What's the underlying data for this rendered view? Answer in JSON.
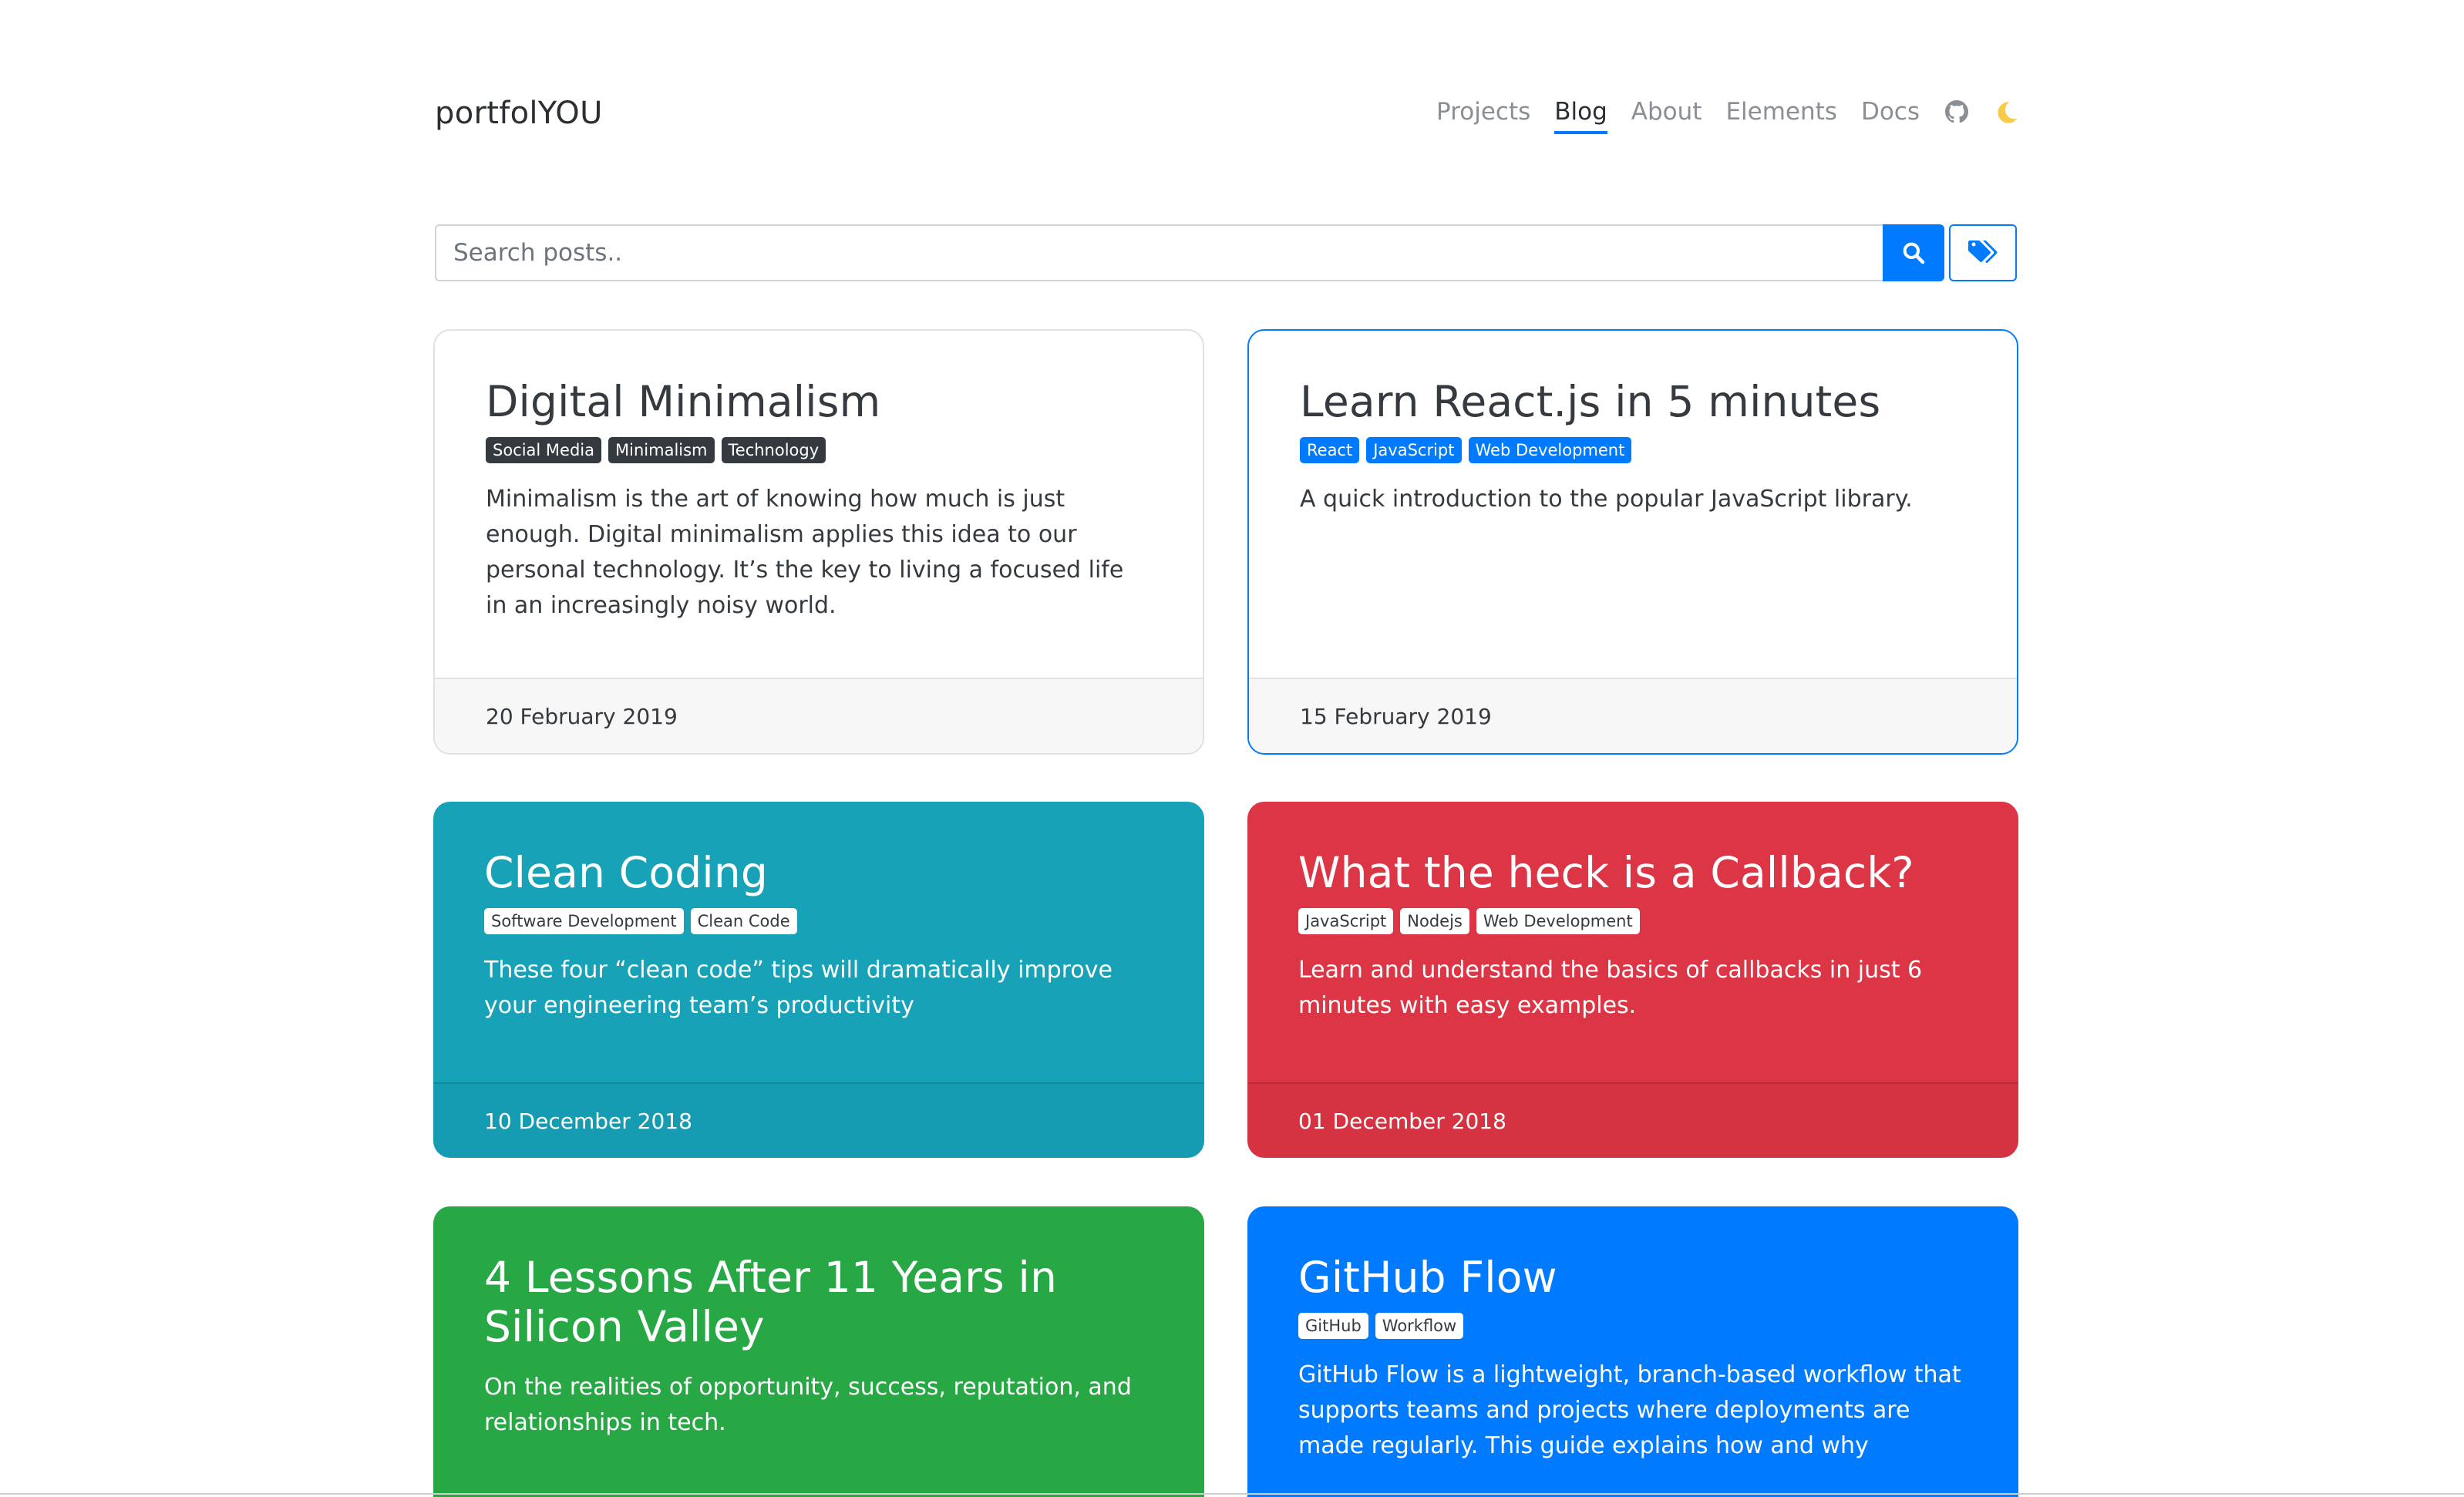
{
  "brand": "portfolYOU",
  "nav": {
    "links": [
      "Projects",
      "Blog",
      "About",
      "Elements",
      "Docs"
    ],
    "active": "Blog",
    "icons": [
      "github-icon",
      "moon-icon"
    ]
  },
  "search": {
    "placeholder": "Search posts..",
    "button_icon": "search-icon",
    "tags_button_icon": "tags-icon"
  },
  "colors": {
    "primary": "#007bff",
    "info": "#17a2b8",
    "danger": "#dc3545",
    "success": "#28a745",
    "dark": "#343a40"
  },
  "posts": [
    {
      "title": "Digital Minimalism",
      "tags": [
        "Social Media",
        "Minimalism",
        "Technology"
      ],
      "excerpt": "Minimalism is the art of knowing how much is just enough. Digital minimalism applies this idea to our personal technology. It’s the key to living a focused life in an increasingly noisy world.",
      "date": "20 February 2019"
    },
    {
      "title": "Learn React.js in 5 minutes",
      "tags": [
        "React",
        "JavaScript",
        "Web Development"
      ],
      "excerpt": "A quick introduction to the popular JavaScript library.",
      "date": "15 February 2019"
    },
    {
      "title": "Clean Coding",
      "tags": [
        "Software Development",
        "Clean Code"
      ],
      "excerpt": "These four “clean code” tips will dramatically improve your engineering team’s productivity",
      "date": "10 December 2018"
    },
    {
      "title": "What the heck is a Callback?",
      "tags": [
        "JavaScript",
        "Nodejs",
        "Web Development"
      ],
      "excerpt": "Learn and understand the basics of callbacks in just 6 minutes with easy examples.",
      "date": "01 December 2018"
    },
    {
      "title": "4 Lessons After 11 Years in Silicon Valley",
      "tags": [],
      "excerpt": "On the realities of opportunity, success, reputation, and relationships in tech.",
      "date": ""
    },
    {
      "title": "GitHub Flow",
      "tags": [
        "GitHub",
        "Workflow"
      ],
      "excerpt": "GitHub Flow is a lightweight, branch-based workflow that supports teams and projects where deployments are made regularly. This guide explains how and why",
      "date": ""
    }
  ]
}
